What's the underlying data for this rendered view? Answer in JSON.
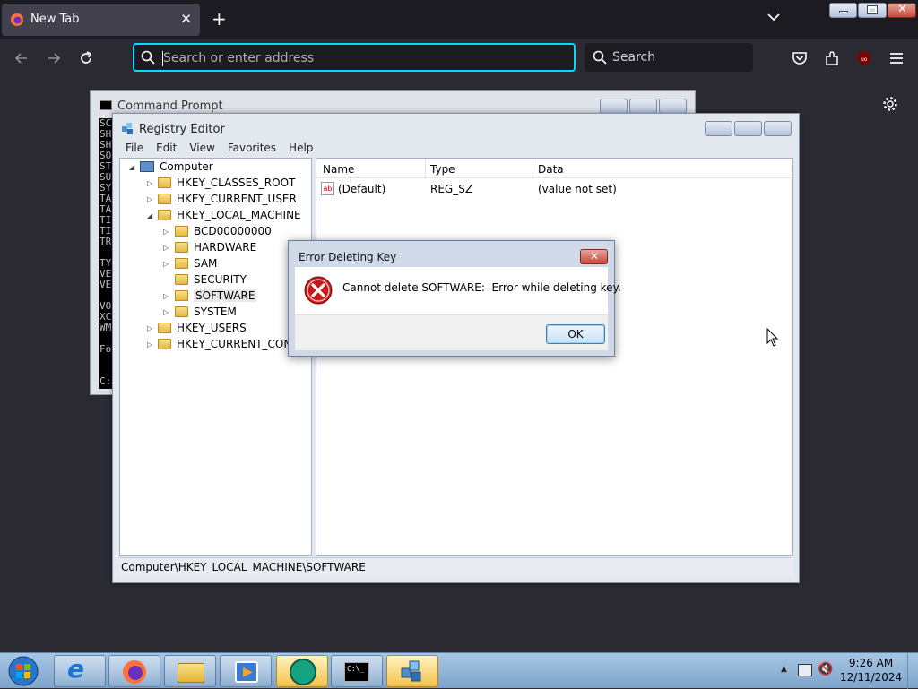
{
  "browser": {
    "tab_title": "New Tab",
    "url_placeholder": "Search or enter address",
    "search_placeholder": "Search"
  },
  "cmd": {
    "title": "Command Prompt",
    "console_lines": [
      "SC",
      "SH",
      "SH",
      "SO",
      "ST",
      "SU",
      "SY",
      "TA",
      "TA",
      "TI",
      "TI",
      "TR",
      "",
      "TY",
      "VE",
      "VE",
      "",
      "VO",
      "XC",
      "WM",
      "",
      "Fo",
      "",
      "",
      "C:"
    ]
  },
  "regedit": {
    "title": "Registry Editor",
    "menu": [
      "File",
      "Edit",
      "View",
      "Favorites",
      "Help"
    ],
    "tree": {
      "root": "Computer",
      "hives": [
        "HKEY_CLASSES_ROOT",
        "HKEY_CURRENT_USER",
        "HKEY_LOCAL_MACHINE",
        "HKEY_USERS",
        "HKEY_CURRENT_CONFIG"
      ],
      "hklm_children": [
        "BCD00000000",
        "HARDWARE",
        "SAM",
        "SECURITY",
        "SOFTWARE",
        "SYSTEM"
      ]
    },
    "columns": [
      "Name",
      "Type",
      "Data"
    ],
    "values": [
      {
        "name": "(Default)",
        "type": "REG_SZ",
        "data": "(value not set)"
      }
    ],
    "status_path": "Computer\\HKEY_LOCAL_MACHINE\\SOFTWARE"
  },
  "dialog": {
    "title": "Error Deleting Key",
    "message": "Cannot delete SOFTWARE:  Error while deleting key.",
    "ok_label": "OK"
  },
  "taskbar": {
    "time": "9:26 AM",
    "date": "12/11/2024",
    "apps": [
      "start-orb",
      "internet-explorer",
      "firefox",
      "file-explorer",
      "media-player",
      "app-green",
      "command-prompt",
      "registry-editor"
    ]
  }
}
